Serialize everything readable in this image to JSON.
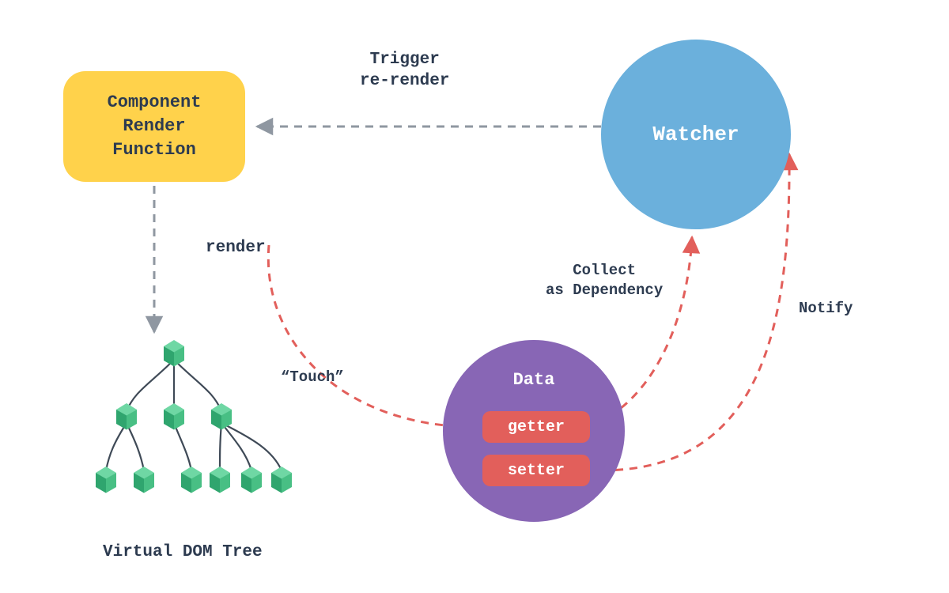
{
  "nodes": {
    "render_function": "Component\nRender\nFunction",
    "watcher": "Watcher",
    "data": "Data",
    "getter": "getter",
    "setter": "setter",
    "vdom_tree": "Virtual DOM Tree"
  },
  "edges": {
    "trigger_rerender": "Trigger\nre-render",
    "render": "render",
    "touch": "“Touch”",
    "collect_dependency": "Collect\nas Dependency",
    "notify": "Notify"
  },
  "colors": {
    "yellow": "#ffd24b",
    "blue": "#6bb0dc",
    "purple": "#8866b5",
    "red": "#e25f5b",
    "green": "#48bf84",
    "text": "#2d3b50",
    "gray_arrow": "#8f97a1",
    "red_arrow": "#e25f5b"
  }
}
